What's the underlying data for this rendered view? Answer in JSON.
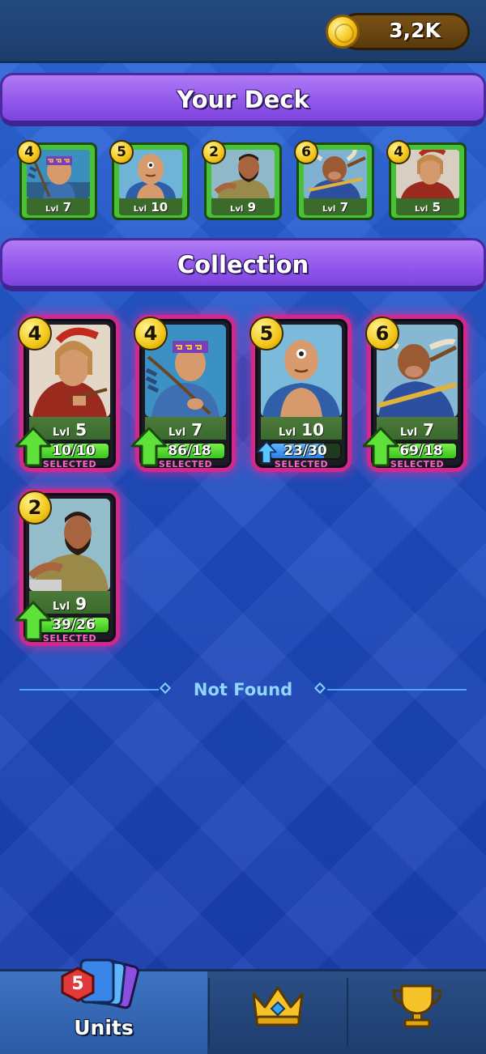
{
  "topbar": {
    "coins": "3,2K",
    "coin_icon": "gold-coin-icon"
  },
  "deck": {
    "title": "Your Deck",
    "cards": [
      {
        "cost": "4",
        "lvl_label": "Lvl",
        "lvl": "7",
        "unit": "archer"
      },
      {
        "cost": "5",
        "lvl_label": "Lvl",
        "lvl": "10",
        "unit": "cyclops"
      },
      {
        "cost": "2",
        "lvl_label": "Lvl",
        "lvl": "9",
        "unit": "bearded-warrior"
      },
      {
        "cost": "6",
        "lvl_label": "Lvl",
        "lvl": "7",
        "unit": "minotaur"
      },
      {
        "cost": "4",
        "lvl_label": "Lvl",
        "lvl": "5",
        "unit": "spartan"
      }
    ]
  },
  "collection": {
    "title": "Collection",
    "cards": [
      {
        "cost": "4",
        "lvl_label": "Lvl",
        "lvl": "5",
        "progress": "10/10",
        "progress_fraction": 1.0,
        "status": "SELECTED",
        "upgrade": "green",
        "unit": "spartan"
      },
      {
        "cost": "4",
        "lvl_label": "Lvl",
        "lvl": "7",
        "progress": "86/18",
        "progress_fraction": 1.0,
        "status": "SELECTED",
        "upgrade": "green",
        "unit": "archer"
      },
      {
        "cost": "5",
        "lvl_label": "Lvl",
        "lvl": "10",
        "progress": "23/30",
        "progress_fraction": 0.77,
        "status": "SELECTED",
        "upgrade": "blue",
        "unit": "cyclops"
      },
      {
        "cost": "6",
        "lvl_label": "Lvl",
        "lvl": "7",
        "progress": "69/18",
        "progress_fraction": 1.0,
        "status": "SELECTED",
        "upgrade": "green",
        "unit": "minotaur"
      },
      {
        "cost": "2",
        "lvl_label": "Lvl",
        "lvl": "9",
        "progress": "39/26",
        "progress_fraction": 1.0,
        "status": "SELECTED",
        "upgrade": "green",
        "unit": "bearded-warrior"
      }
    ],
    "not_found": "Not Found"
  },
  "nav": {
    "units_label": "Units",
    "units_badge": "5",
    "tabs": [
      "units-cards-icon",
      "crown-icon",
      "trophy-icon"
    ]
  },
  "colors": {
    "accent_purple": "#9156ec",
    "selected_pink": "#d0288c",
    "deck_green": "#47c236",
    "coin_gold": "#f2c619"
  }
}
